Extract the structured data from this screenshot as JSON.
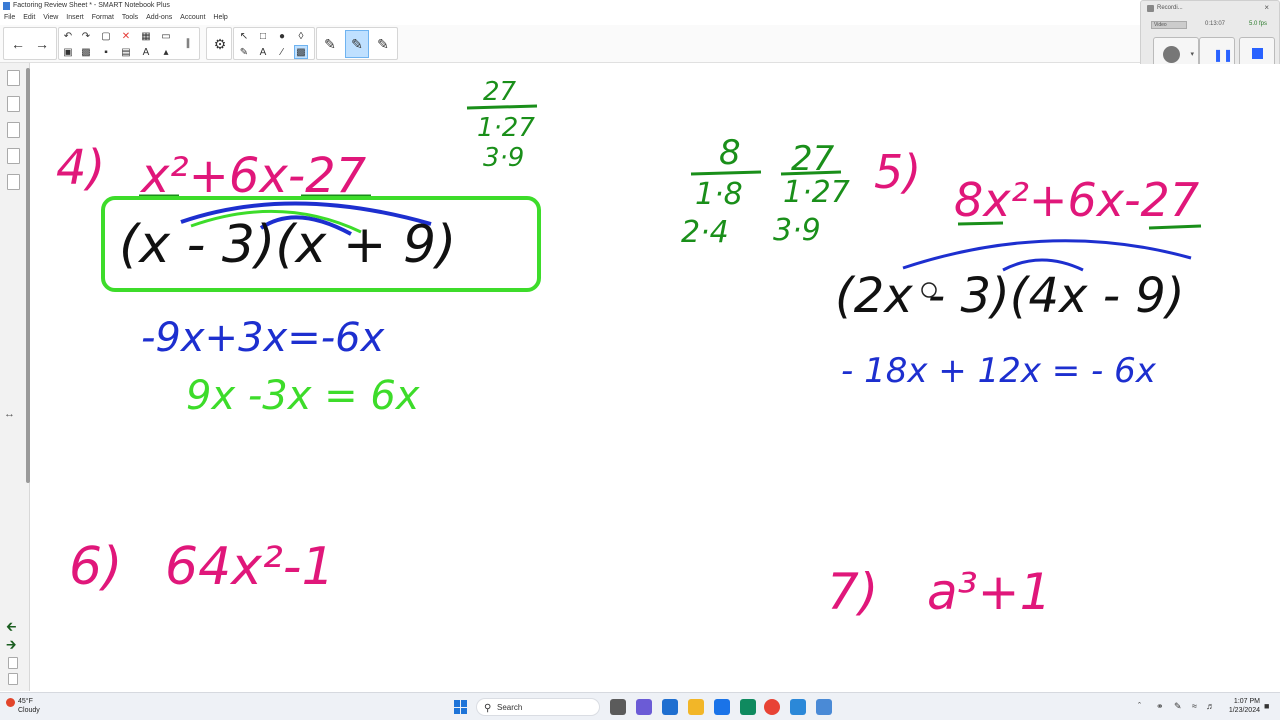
{
  "window": {
    "title": "Factoring Review Sheet * - SMART Notebook Plus"
  },
  "menu": [
    "File",
    "Edit",
    "View",
    "Insert",
    "Format",
    "Tools",
    "Add-ons",
    "Account",
    "Help"
  ],
  "toolbar": {
    "buttons": [
      "back-arrow",
      "forward-arrow",
      "undo",
      "redo",
      "delete",
      "table",
      "screen-shade",
      "select",
      "magic-pen",
      "pen",
      "line",
      "text",
      "eraser",
      "fill",
      "pen-style-1",
      "pen-style-2",
      "pen-style-3"
    ],
    "selected_tool": "pen-style-2"
  },
  "recorder": {
    "title": "Recordi...",
    "time": "0:13:07",
    "fps": "5.0 fps",
    "dropdown": "Video"
  },
  "whiteboard": {
    "colors": {
      "pink": "#e0177a",
      "green": "#1a8f1a",
      "blue": "#1d2fcf",
      "lime": "#3ddc2a",
      "red": "#e02020",
      "black": "#111111"
    },
    "problem4": {
      "number": "4)",
      "expression": "x²+6x-27",
      "factors_of_27": [
        "27",
        "1·27",
        "3·9"
      ],
      "factored": "(x - 3)(x + 9)",
      "check_blue": "-9x+3x=-6x",
      "check_green": "9x -3x = 6x"
    },
    "problem5": {
      "number": "5)",
      "expression": "8x²+6x-27",
      "factors_of_8": [
        "8",
        "1·8",
        "2·4"
      ],
      "factors_of_27": [
        "27",
        "1·27",
        "3·9"
      ],
      "factored": "(2x - 3)(4x - 9)",
      "check_blue": "- 18x + 12x = - 6x"
    },
    "problem6": {
      "number": "6)",
      "expression": "64x²-1"
    },
    "problem7": {
      "number": "7)",
      "expression": "a³+1"
    }
  },
  "taskbar": {
    "weather_temp": "45°F",
    "weather_desc": "Cloudy",
    "search_placeholder": "Search",
    "clock_time": "1:07 PM",
    "clock_date": "1/23/2024"
  }
}
